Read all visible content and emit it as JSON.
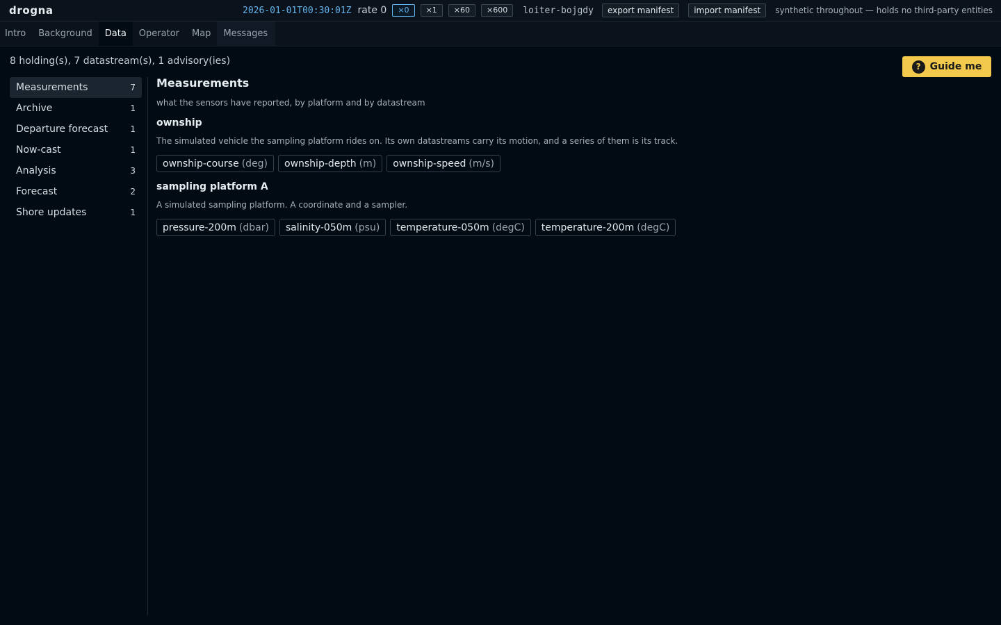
{
  "app": {
    "brand": "drogna",
    "clock": "2026-01-01T00:30:01Z",
    "rate_label": "rate 0",
    "rate_buttons": [
      "×0",
      "×1",
      "×60",
      "×600"
    ],
    "scenario": "loiter-bojgdy",
    "export_label": "export manifest",
    "import_label": "import manifest",
    "disclaimer": "synthetic throughout — holds no third-party entities"
  },
  "tabs": [
    "Intro",
    "Background",
    "Data",
    "Operator",
    "Map",
    "Messages"
  ],
  "summary": "8 holding(s), 7 datastream(s), 1 advisory(ies)",
  "guide": {
    "icon": "question-icon",
    "label": "Guide me"
  },
  "sidebar": {
    "items": [
      {
        "label": "Measurements",
        "count": "7"
      },
      {
        "label": "Archive",
        "count": "1"
      },
      {
        "label": "Departure forecast",
        "count": "1"
      },
      {
        "label": "Now-cast",
        "count": "1"
      },
      {
        "label": "Analysis",
        "count": "3"
      },
      {
        "label": "Forecast",
        "count": "2"
      },
      {
        "label": "Shore updates",
        "count": "1"
      }
    ]
  },
  "main": {
    "title": "Measurements",
    "subtitle": "what the sensors have reported, by platform and by datastream",
    "platforms": [
      {
        "name": "ownship",
        "description": "The simulated vehicle the sampling platform rides on. Its own datastreams carry its motion, and a series of them is its track.",
        "streams": [
          {
            "name": "ownship-course",
            "unit": "(deg)"
          },
          {
            "name": "ownship-depth",
            "unit": "(m)"
          },
          {
            "name": "ownship-speed",
            "unit": "(m/s)"
          }
        ]
      },
      {
        "name": "sampling platform A",
        "description": "A simulated sampling platform. A coordinate and a sampler.",
        "streams": [
          {
            "name": "pressure-200m",
            "unit": "(dbar)"
          },
          {
            "name": "salinity-050m",
            "unit": "(psu)"
          },
          {
            "name": "temperature-050m",
            "unit": "(degC)"
          },
          {
            "name": "temperature-200m",
            "unit": "(degC)"
          }
        ]
      }
    ]
  },
  "colors": {
    "background": "#020b14",
    "accent": "#63b3ed",
    "guide": "#f2c94c"
  }
}
